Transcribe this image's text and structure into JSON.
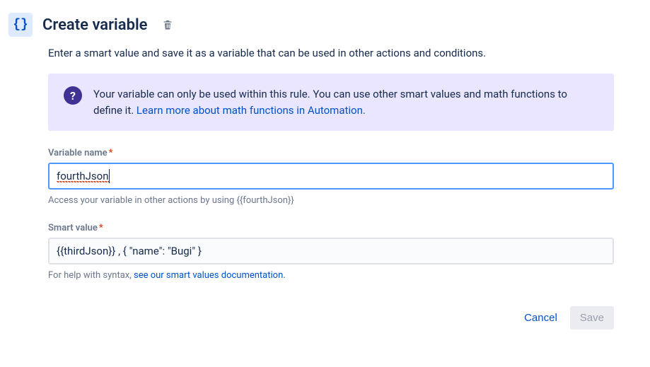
{
  "header": {
    "icon_glyph": "{}",
    "title": "Create variable"
  },
  "description": "Enter a smart value and save it as a variable that can be used in other actions and conditions.",
  "info": {
    "text_before_link": "Your variable can only be used within this rule. You can use other smart values and math functions to define it. ",
    "link_text": "Learn more about math functions in Automation."
  },
  "fields": {
    "variable_name": {
      "label": "Variable name",
      "required": true,
      "value": "fourthJson",
      "helper": "Access your variable in other actions by using {{fourthJson}}"
    },
    "smart_value": {
      "label": "Smart value",
      "required": true,
      "value": "{{thirdJson}} , { \"name\": \"Bugi\" }",
      "helper_before_link": "For help with syntax, ",
      "helper_link": "see our smart values documentation."
    }
  },
  "footer": {
    "cancel_label": "Cancel",
    "save_label": "Save"
  }
}
